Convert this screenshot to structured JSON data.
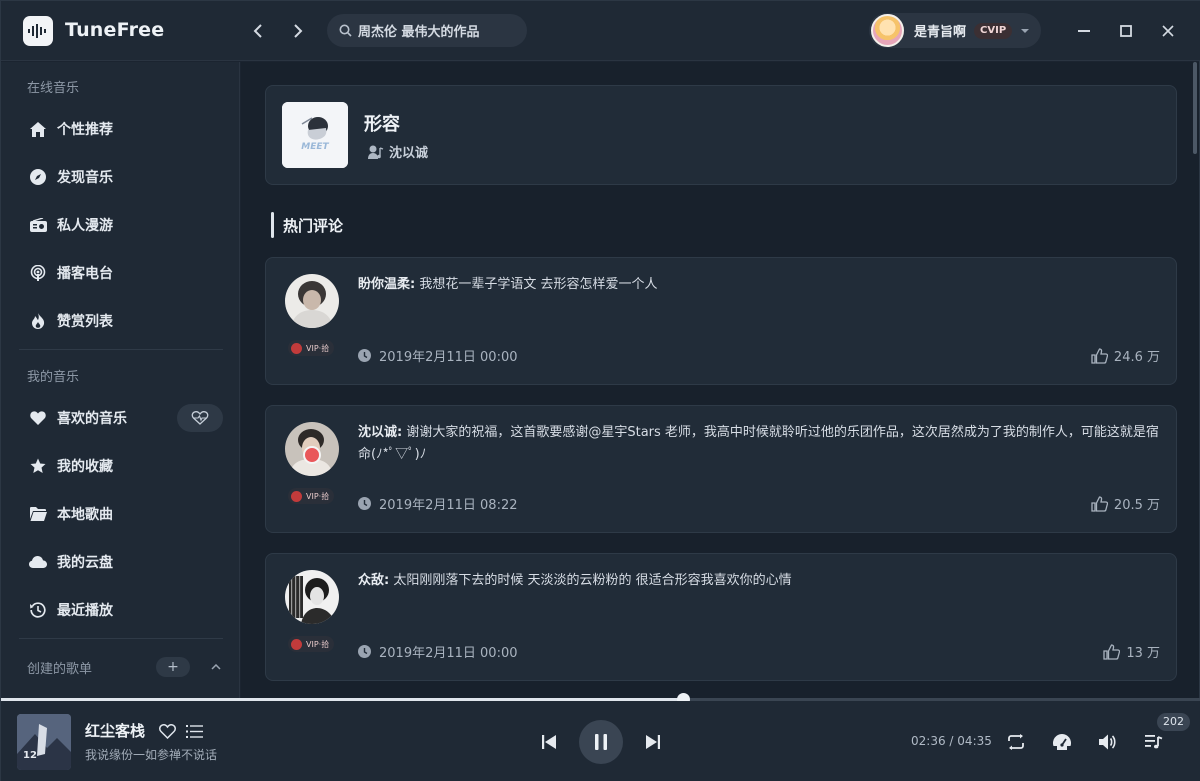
{
  "app": {
    "name": "TuneFree"
  },
  "header": {
    "search_text": "周杰伦 最伟大的作品",
    "user_name": "是青旨啊",
    "vip_badge": "CVIP"
  },
  "sidebar": {
    "online_label": "在线音乐",
    "online_items": [
      {
        "label": "个性推荐",
        "icon": "home-icon"
      },
      {
        "label": "发现音乐",
        "icon": "compass-icon"
      },
      {
        "label": "私人漫游",
        "icon": "radio-icon"
      },
      {
        "label": "播客电台",
        "icon": "podcast-icon"
      },
      {
        "label": "赞赏列表",
        "icon": "fire-icon"
      }
    ],
    "my_label": "我的音乐",
    "my_items": [
      {
        "label": "喜欢的音乐",
        "icon": "heart-icon"
      },
      {
        "label": "我的收藏",
        "icon": "star-icon"
      },
      {
        "label": "本地歌曲",
        "icon": "folder-icon"
      },
      {
        "label": "我的云盘",
        "icon": "cloud-icon"
      },
      {
        "label": "最近播放",
        "icon": "history-icon"
      }
    ],
    "created_label": "创建的歌单",
    "add_label": "+"
  },
  "song": {
    "title": "形容",
    "artist": "沈以诚"
  },
  "comments_section": {
    "title": "热门评论"
  },
  "comments": [
    {
      "user": "盼你温柔:",
      "text": "我想花一辈子学语文 去形容怎样爱一个人",
      "time": "2019年2月11日 00:00",
      "likes": "24.6 万",
      "badge": "VIP·拾"
    },
    {
      "user": "沈以诚:",
      "text": "谢谢大家的祝福，这首歌要感谢@星宇Stars 老师，我高中时候就聆听过他的乐团作品，这次居然成为了我的制作人，可能这就是宿命(ﾉ*ﾟ▽ﾟ)ﾉ",
      "time": "2019年2月11日 08:22",
      "likes": "20.5 万",
      "badge": "VIP·拾"
    },
    {
      "user": "众敌:",
      "text": "太阳刚刚落下去的时候 天淡淡的云粉粉的 很适合形容我喜欢你的心情",
      "time": "2019年2月11日 00:00",
      "likes": "13 万",
      "badge": "VIP·拾"
    }
  ],
  "player": {
    "title": "红尘客栈",
    "subtitle": "我说缘份一如参禅不说话",
    "current_time": "02:36",
    "separator": "/",
    "total_time": "04:35",
    "progress": 0.5686,
    "queue_count": "202"
  }
}
